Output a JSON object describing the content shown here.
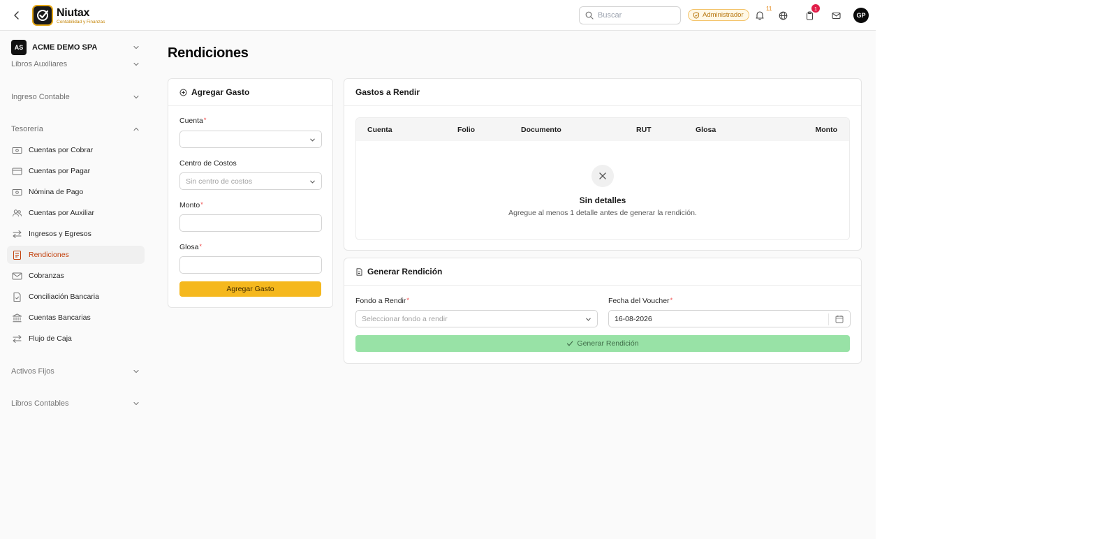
{
  "header": {
    "logo_name": "Niutax",
    "logo_sub": "Contabilidad y Finanzas",
    "search_placeholder": "Buscar",
    "role": "Administrador",
    "notifications_count": "11",
    "tasks_count": "1",
    "avatar_initials": "GP"
  },
  "sidebar": {
    "company_initials": "AS",
    "company_name": "ACME DEMO SPA",
    "sections": {
      "libros_auxiliares": "Libros Auxiliares",
      "ingreso_contable": "Ingreso Contable",
      "tesoreria": "Tesorería",
      "activos_fijos": "Activos Fijos",
      "libros_contables": "Libros Contables"
    },
    "items": [
      {
        "label": "Cuentas por Cobrar",
        "icon": "banknote-icon"
      },
      {
        "label": "Cuentas por Pagar",
        "icon": "credit-card-icon"
      },
      {
        "label": "Nómina de Pago",
        "icon": "banknote-icon"
      },
      {
        "label": "Cuentas por Auxiliar",
        "icon": "users-icon"
      },
      {
        "label": "Ingresos y Egresos",
        "icon": "arrows-exchange-icon"
      },
      {
        "label": "Rendiciones",
        "icon": "receipt-icon",
        "active": true
      },
      {
        "label": "Cobranzas",
        "icon": "mail-icon"
      },
      {
        "label": "Conciliación Bancaria",
        "icon": "file-check-icon"
      },
      {
        "label": "Cuentas Bancarias",
        "icon": "bank-icon"
      },
      {
        "label": "Flujo de Caja",
        "icon": "arrows-exchange-icon"
      }
    ]
  },
  "main": {
    "title": "Rendiciones",
    "add_expense": {
      "title": "Agregar Gasto",
      "cuenta_label": "Cuenta",
      "cuenta_value": "",
      "centro_label": "Centro de Costos",
      "centro_placeholder": "Sin centro de costos",
      "monto_label": "Monto",
      "monto_value": "",
      "glosa_label": "Glosa",
      "glosa_value": "",
      "button": "Agregar Gasto"
    },
    "expenses": {
      "title": "Gastos a Rendir",
      "columns": [
        "Cuenta",
        "Folio",
        "Documento",
        "RUT",
        "Glosa",
        "Monto"
      ],
      "rows": [],
      "empty_title": "Sin detalles",
      "empty_desc": "Agregue al menos 1 detalle antes de generar la rendición."
    },
    "generate": {
      "title": "Generar Rendición",
      "fondo_label": "Fondo a Rendir",
      "fondo_placeholder": "Seleccionar fondo a rendir",
      "fecha_label": "Fecha del Voucher",
      "fecha_value": "16-08-2026",
      "button": "Generar Rendición"
    }
  },
  "colors": {
    "accent": "#f5b81e",
    "active_text": "#c2410c",
    "generate_button": "#98e2a6",
    "required": "#ef4444"
  }
}
